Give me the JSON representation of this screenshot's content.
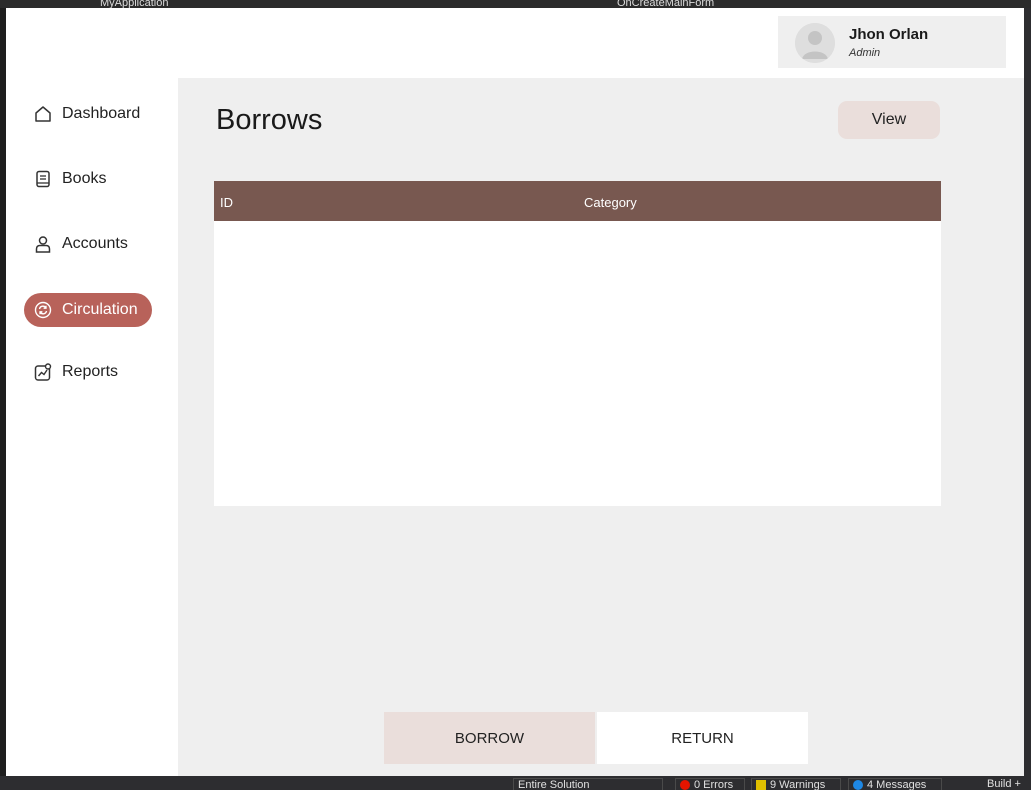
{
  "ide": {
    "top_left_text": "MyApplication",
    "top_right_text": "OnCreateMainForm",
    "scope": "Entire Solution",
    "errors": "0 Errors",
    "warnings": "9 Warnings",
    "messages": "4 Messages",
    "build": "Build +"
  },
  "user": {
    "name": "Jhon Orlan",
    "role": "Admin",
    "avatar_icon": "user-avatar-icon"
  },
  "sidebar": {
    "items": [
      {
        "label": "Dashboard",
        "icon": "home-icon",
        "active": false
      },
      {
        "label": "Books",
        "icon": "book-icon",
        "active": false
      },
      {
        "label": "Accounts",
        "icon": "user-icon",
        "active": false
      },
      {
        "label": "Circulation",
        "icon": "refresh-icon",
        "active": true
      },
      {
        "label": "Reports",
        "icon": "chart-icon",
        "active": false
      }
    ]
  },
  "main": {
    "title": "Borrows",
    "view_label": "View",
    "table": {
      "columns": [
        "ID",
        "Category"
      ],
      "rows": []
    },
    "borrow_label": "BORROW",
    "return_label": "RETURN"
  },
  "colors": {
    "accent": "#b8625a",
    "table_header": "#785850",
    "button_tint": "#eadedb",
    "main_bg": "#efefef"
  }
}
